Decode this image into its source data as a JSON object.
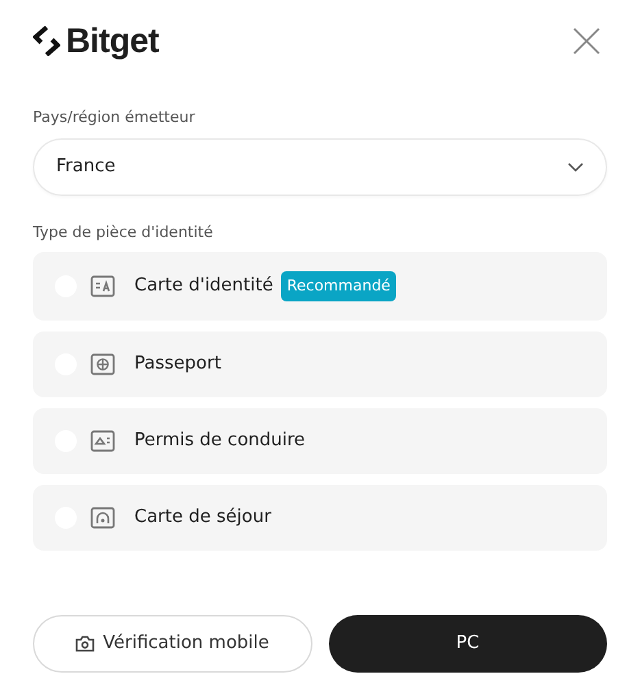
{
  "header": {
    "logo": "Bitget"
  },
  "country": {
    "label": "Pays/région émetteur",
    "value": "France"
  },
  "document_type": {
    "label": "Type de pièce d'identité",
    "options": [
      {
        "kind": "id-card",
        "label": "Carte d'identité",
        "badge": "Recommandé",
        "selected": false
      },
      {
        "kind": "passport",
        "label": "Passeport",
        "selected": false
      },
      {
        "kind": "license",
        "label": "Permis de conduire",
        "selected": false
      },
      {
        "kind": "residence",
        "label": "Carte de séjour",
        "selected": false
      }
    ]
  },
  "buttons": [
    {
      "kind": "outline",
      "label": "Vérification mobile"
    },
    {
      "kind": "primary",
      "label": "PC"
    }
  ]
}
